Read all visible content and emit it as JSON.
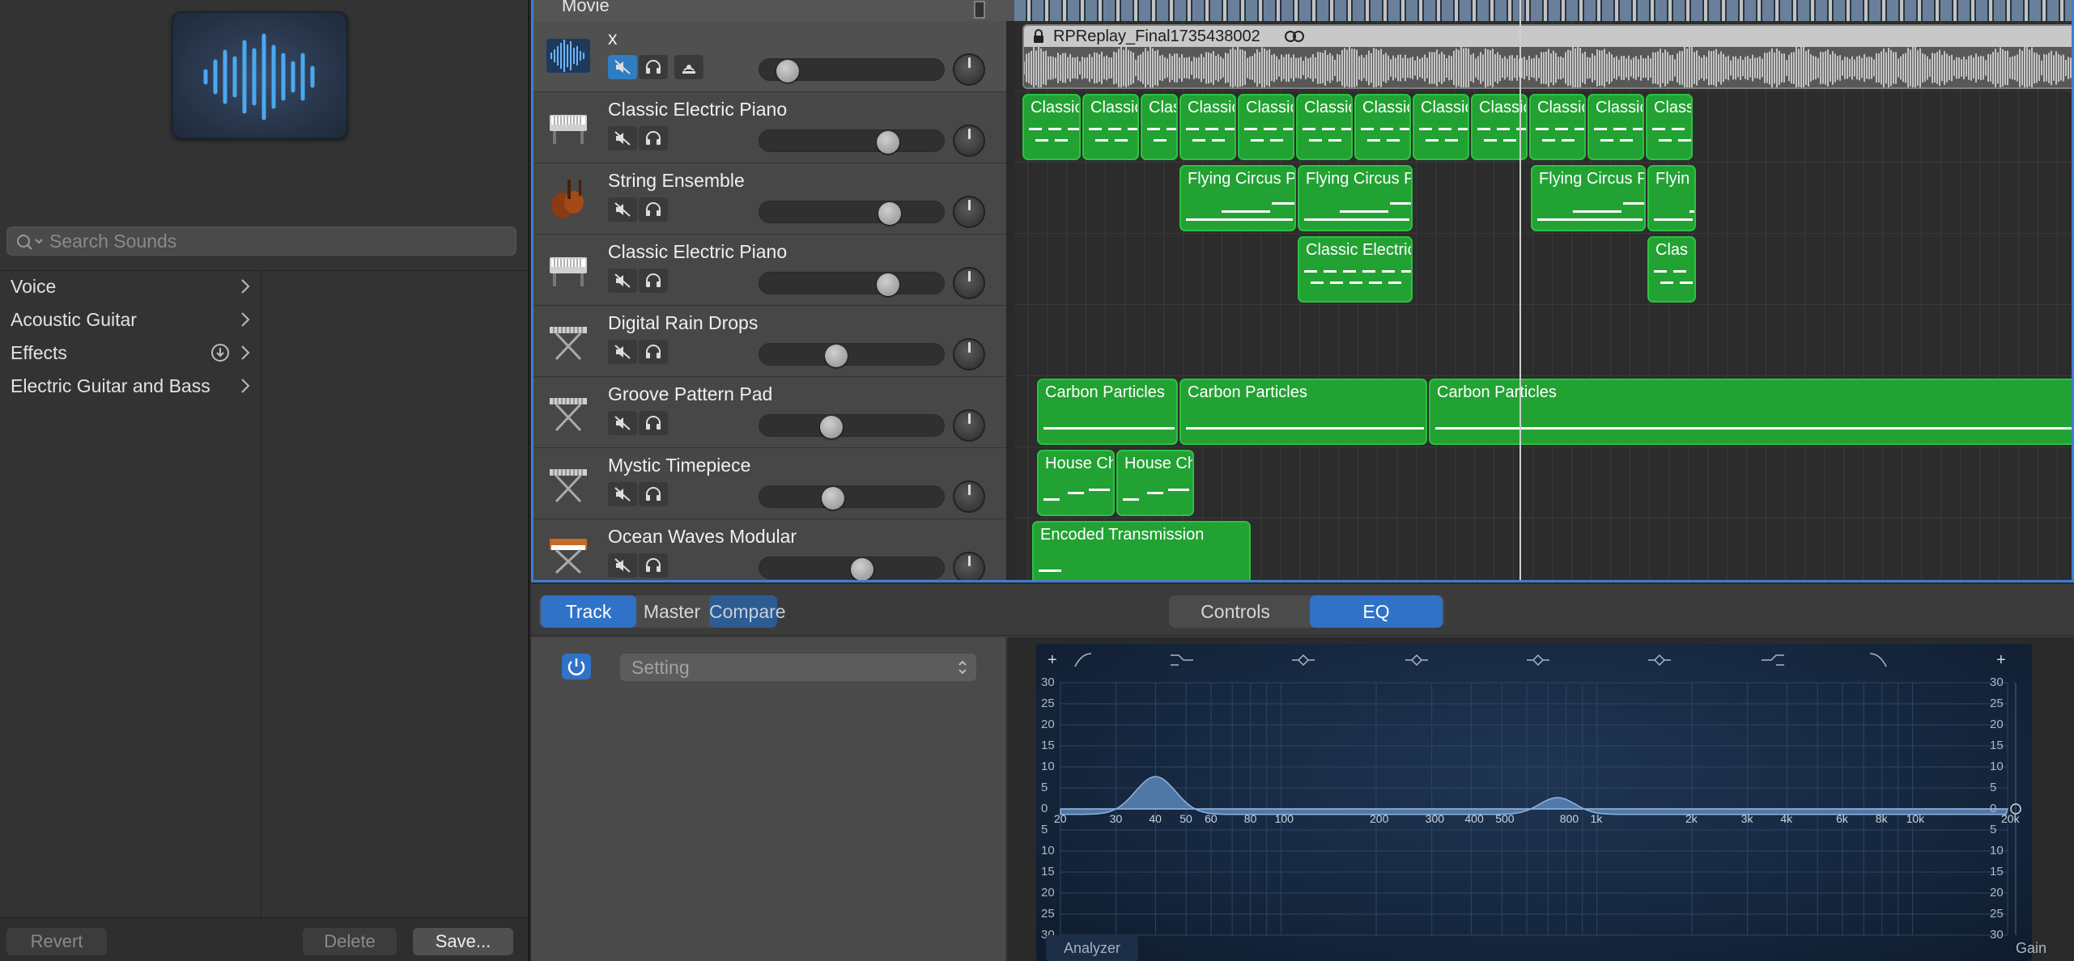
{
  "library": {
    "search_placeholder": "Search Sounds",
    "items": [
      {
        "label": "Voice",
        "download": false
      },
      {
        "label": "Acoustic Guitar",
        "download": false
      },
      {
        "label": "Effects",
        "download": true
      },
      {
        "label": "Electric Guitar and Bass",
        "download": false
      }
    ],
    "buttons": {
      "revert": "Revert",
      "delete": "Delete",
      "save": "Save..."
    }
  },
  "movie_track": {
    "label": "Movie"
  },
  "tracks": [
    {
      "name": "x",
      "icon": "audio-waveform-icon",
      "mute_active": true,
      "has_monitor": true,
      "volume": 0.1
    },
    {
      "name": "Classic Electric Piano",
      "icon": "electric-piano-icon",
      "mute_active": false,
      "has_monitor": false,
      "volume": 0.72
    },
    {
      "name": "String Ensemble",
      "icon": "violin-icon",
      "mute_active": false,
      "has_monitor": false,
      "volume": 0.73
    },
    {
      "name": "Classic Electric Piano",
      "icon": "electric-piano-icon",
      "mute_active": false,
      "has_monitor": false,
      "volume": 0.72
    },
    {
      "name": "Digital Rain Drops",
      "icon": "keyboard-stand-icon",
      "mute_active": false,
      "has_monitor": false,
      "volume": 0.4
    },
    {
      "name": "Groove Pattern Pad",
      "icon": "keyboard-stand-icon",
      "mute_active": false,
      "has_monitor": false,
      "volume": 0.37
    },
    {
      "name": "Mystic Timepiece",
      "icon": "keyboard-stand-icon",
      "mute_active": false,
      "has_monitor": false,
      "volume": 0.38
    },
    {
      "name": "Ocean Waves Modular",
      "icon": "synth-keyboard-icon",
      "mute_active": false,
      "has_monitor": false,
      "volume": 0.56
    }
  ],
  "timeline": {
    "audio_region": {
      "title": "RPReplay_Final1735438002"
    },
    "region_labels": {
      "piano": "Classic Ele",
      "flying": "Flying Circus Piano",
      "piano2": "Classic Electric Piano",
      "piano2_cut": "Clas",
      "carbon": "Carbon Particles",
      "house": "House Chords",
      "encoded": "Encoded Transmission",
      "flying_cut": "Flyin"
    }
  },
  "editor": {
    "tabs": {
      "track": "Track",
      "master": "Master",
      "compare": "Compare"
    },
    "view_tabs": {
      "controls": "Controls",
      "eq": "EQ"
    },
    "setting_label": "Setting",
    "freq_labels": [
      "20",
      "30",
      "40",
      "50",
      "60",
      "80",
      "100",
      "200",
      "300",
      "400",
      "500",
      "800",
      "1k",
      "2k",
      "3k",
      "4k",
      "6k",
      "8k",
      "10k",
      "20k"
    ],
    "gain_labels": [
      "30",
      "25",
      "20",
      "15",
      "10",
      "5",
      "0",
      "5",
      "10",
      "15",
      "20",
      "25",
      "30"
    ],
    "analyzer_label": "Analyzer",
    "gain_label": "Gain",
    "accent_color": "#2f72c8",
    "region_color": "#22a233"
  }
}
